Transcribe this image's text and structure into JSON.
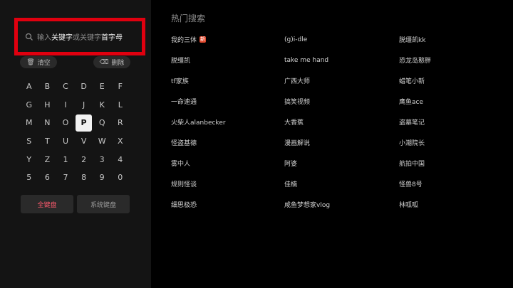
{
  "search": {
    "prefix": "输入",
    "keyword": "关键字",
    "middle": "或关键字",
    "initials": "首字母"
  },
  "actions": {
    "clear_label": "清空",
    "delete_label": "删除"
  },
  "keyboard": {
    "keys": [
      "A",
      "B",
      "C",
      "D",
      "E",
      "F",
      "G",
      "H",
      "I",
      "J",
      "K",
      "L",
      "M",
      "N",
      "O",
      "P",
      "Q",
      "R",
      "S",
      "T",
      "U",
      "V",
      "W",
      "X",
      "Y",
      "Z",
      "1",
      "2",
      "3",
      "4",
      "5",
      "6",
      "7",
      "8",
      "9",
      "0"
    ],
    "active_key": "P"
  },
  "tabs": {
    "full_label": "全键盘",
    "system_label": "系统键盘"
  },
  "hot": {
    "title": "热门搜索",
    "items": [
      "我的三体",
      "(g)i-dle",
      "脱缰凯kk",
      "脱缰凯",
      "take me hand",
      "恐龙岛憨胖",
      "tf家族",
      "广西大师",
      "蜡笔小新",
      "一命速通",
      "搞笑视频",
      "鹰鱼ace",
      "火柴人alanbecker",
      "大香蕉",
      "盗墓笔记",
      "怪盗基德",
      "漫画解说",
      "小潮院长",
      "雾中人",
      "阿婆",
      "航拍中国",
      "规则怪谈",
      "佳楠",
      "怪兽8号",
      "细思极恐",
      "咸鱼梦想家vlog",
      "林呱呱"
    ],
    "badge_text": "新"
  },
  "colors": {
    "accent_red": "#e0000f",
    "tab_active": "#ff5a6e"
  }
}
